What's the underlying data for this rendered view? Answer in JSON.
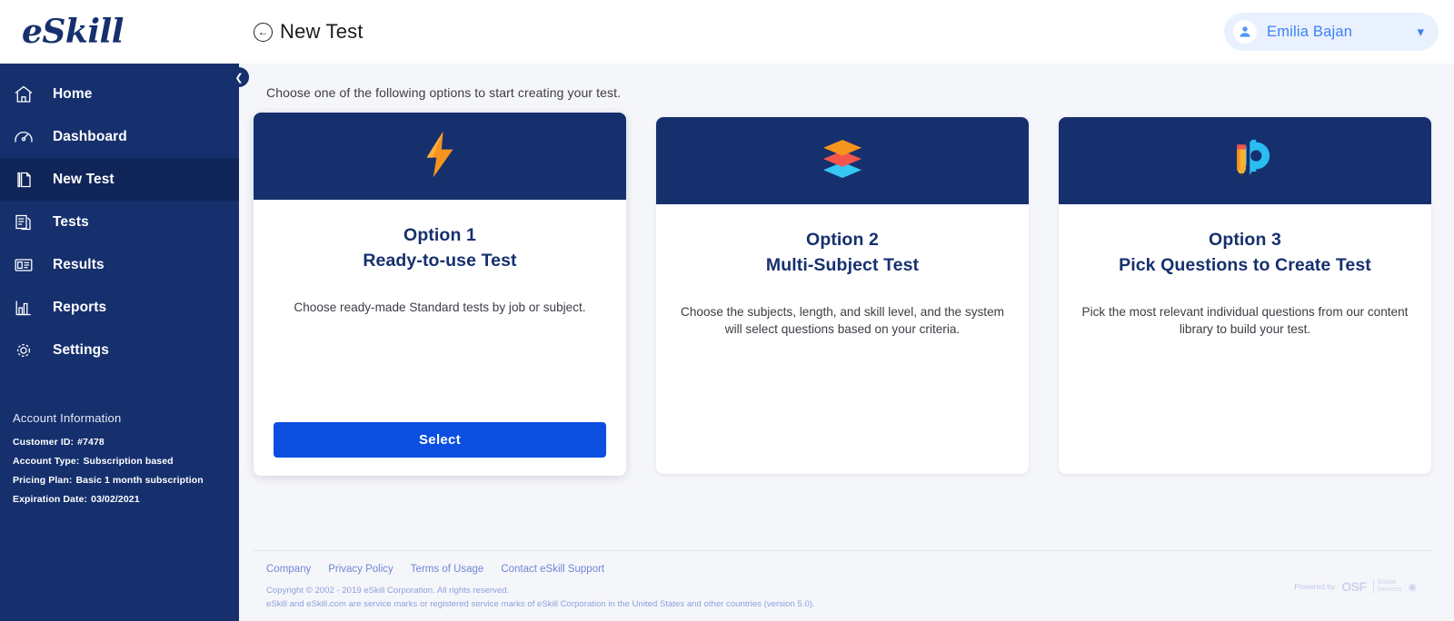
{
  "brand": {
    "logo_text": "eSkill",
    "navy": "#16306e",
    "accent_blue": "#0b4ee0",
    "link_blue": "#6f86d6",
    "user_blue": "#3b82f6"
  },
  "sidebar": {
    "items": [
      {
        "label": "Home",
        "icon": "home-icon",
        "active": false
      },
      {
        "label": "Dashboard",
        "icon": "dashboard-gauge-icon",
        "active": false
      },
      {
        "label": "New Test",
        "icon": "new-test-page-icon",
        "active": true
      },
      {
        "label": "Tests",
        "icon": "tests-documents-icon",
        "active": false
      },
      {
        "label": "Results",
        "icon": "results-card-icon",
        "active": false
      },
      {
        "label": "Reports",
        "icon": "reports-bar-chart-icon",
        "active": false
      },
      {
        "label": "Settings",
        "icon": "settings-gear-icon",
        "active": false
      }
    ],
    "account": {
      "title": "Account Information",
      "rows": [
        {
          "label": "Customer ID:",
          "value": "#7478"
        },
        {
          "label": "Account Type:",
          "value": "Subscription based"
        },
        {
          "label": "Pricing Plan:",
          "value": "Basic 1 month subscription"
        },
        {
          "label": "Expiration Date:",
          "value": "03/02/2021"
        }
      ]
    },
    "collapse_icon": "chevron-left-icon"
  },
  "header": {
    "back_icon": "circled-arrow-left-icon",
    "title": "New Test",
    "user": {
      "name": "Emilia Bajan",
      "avatar_icon": "user-avatar-icon",
      "chevron_icon": "chevron-down-icon"
    }
  },
  "main": {
    "subtitle": "Choose one of the following options to start creating your test.",
    "cards": [
      {
        "icon": "lightning-bolt-icon",
        "title_line1": "Option 1",
        "title_line2": "Ready-to-use Test",
        "description": "Choose ready-made Standard tests by job or subject.",
        "button_label": "Select",
        "has_button": true
      },
      {
        "icon": "stacked-layers-icon",
        "title_line1": "Option 2",
        "title_line2": "Multi-Subject Test",
        "description": "Choose the subjects, length, and skill level, and the system will select questions based on your criteria.",
        "button_label": "",
        "has_button": false
      },
      {
        "icon": "pencil-gear-icon",
        "title_line1": "Option 3",
        "title_line2": "Pick Questions to Create Test",
        "description": "Pick the most relevant individual questions from our content library to build your test.",
        "button_label": "",
        "has_button": false
      }
    ]
  },
  "footer": {
    "links": [
      "Company",
      "Privacy Policy",
      "Terms of Usage",
      "Contact eSkill Support"
    ],
    "copyright_line1": "Copyright © 2002 - 2019 eSkill Corporation. All rights reserved.",
    "copyright_line2": "eSkill and eSkill.com are service marks or registered service marks of eSkill Corporation in the United States and other countries (version 5.0).",
    "powered_by_label": "Powered by",
    "powered_by_brand": "OSF",
    "powered_by_brand_sub_line1": "Global",
    "powered_by_brand_sub_line2": "Services"
  }
}
